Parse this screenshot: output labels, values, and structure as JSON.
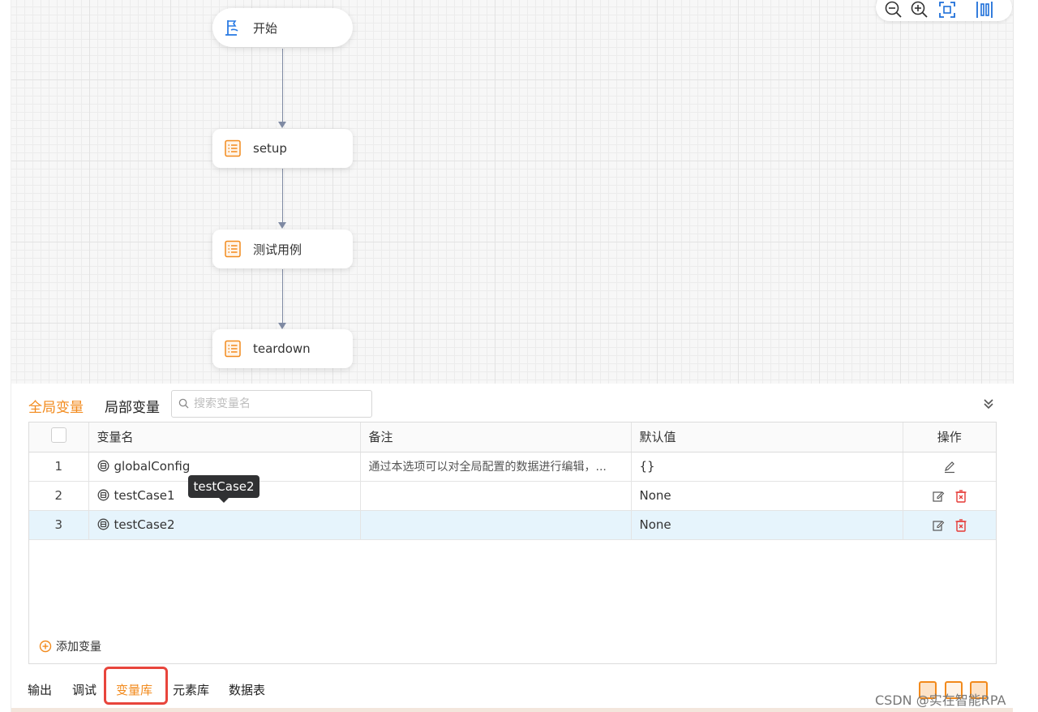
{
  "canvas": {
    "zoom_controls": [
      "zoom-out-icon",
      "zoom-in-icon",
      "fit-screen-icon",
      "align-icon"
    ],
    "nodes": [
      {
        "label": "开始",
        "icon": "flag-icon"
      },
      {
        "label": "setup",
        "icon": "list-icon"
      },
      {
        "label": "测试用例",
        "icon": "list-icon"
      },
      {
        "label": "teardown",
        "icon": "list-icon"
      }
    ]
  },
  "panel": {
    "tab_global": "全局变量",
    "tab_local": "局部变量",
    "search_placeholder": "搜索变量名",
    "columns": {
      "name": "变量名",
      "note": "备注",
      "default": "默认值",
      "ops": "操作"
    },
    "rows": [
      {
        "index": "1",
        "name": "globalConfig",
        "note": "通过本选项可以对全局配置的数据进行编辑，...",
        "default": "{}"
      },
      {
        "index": "2",
        "name": "testCase1",
        "note": "",
        "default": "None"
      },
      {
        "index": "3",
        "name": "testCase2",
        "note": "",
        "default": "None"
      }
    ],
    "add_variable": "添加变量",
    "tooltip": "testCase2"
  },
  "bottom_tabs": [
    "输出",
    "调试",
    "变量库",
    "元素库",
    "数据表"
  ],
  "active_tab": "变量库",
  "watermark": "CSDN @实在智能RPA",
  "colors": {
    "accent": "#f28a1c",
    "highlight": "#e8453c",
    "selected_row": "#e6f4fc",
    "delete": "#e53935"
  }
}
